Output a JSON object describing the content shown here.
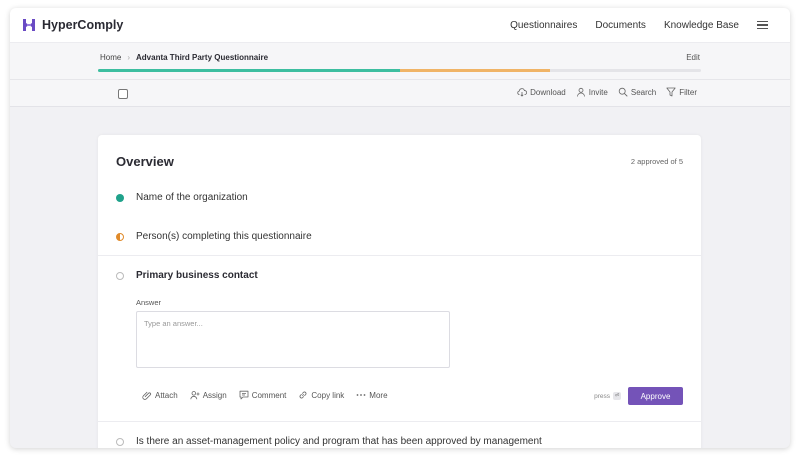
{
  "app": {
    "name": "HyperComply"
  },
  "nav": {
    "items": [
      "Questionnaires",
      "Documents",
      "Knowledge Base"
    ]
  },
  "breadcrumb": {
    "home": "Home",
    "current": "Advanta Third Party Questionnaire",
    "edit": "Edit"
  },
  "progress": {
    "approved_fraction": 0.5,
    "in_progress_fraction": 0.25,
    "approved_color": "#3dbea0",
    "in_progress_color": "#f0b467"
  },
  "toolbar": {
    "download": "Download",
    "invite": "Invite",
    "search": "Search",
    "filter": "Filter"
  },
  "section": {
    "title": "Overview",
    "approved_count": "2 approved of 5",
    "questions": [
      {
        "text": "Name of the organization",
        "status": "approved"
      },
      {
        "text": "Person(s) completing this questionnaire",
        "status": "in-progress"
      },
      {
        "text": "Primary business contact",
        "status": "open"
      },
      {
        "text": "Is there an asset-management policy and program that has been approved by management",
        "status": "open"
      }
    ]
  },
  "answer": {
    "label": "Answer",
    "placeholder": "Type an answer...",
    "value": ""
  },
  "actions": {
    "attach": "Attach",
    "assign": "Assign",
    "comment": "Comment",
    "copy_link": "Copy link",
    "more": "More",
    "press_hint": "press",
    "shortcut_key": "⏎",
    "approve": "Approve"
  },
  "colors": {
    "accent": "#7453b8",
    "approved": "#20a28b",
    "in_progress": "#e08a2a"
  }
}
